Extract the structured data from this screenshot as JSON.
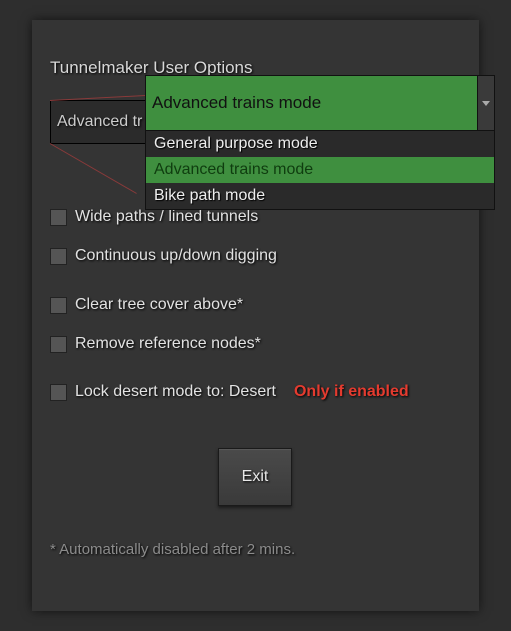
{
  "title": "Tunnelmaker User Options",
  "combo_visible_text": "Advanced tr",
  "dropdown": {
    "selected": "Advanced trains mode",
    "items": [
      {
        "label": "General purpose mode",
        "highlight": false
      },
      {
        "label": "Advanced trains mode",
        "highlight": true
      },
      {
        "label": "Bike path mode",
        "highlight": false
      }
    ]
  },
  "checks": {
    "wide_paths": "Wide paths / lined tunnels",
    "continuous": "Continuous up/down digging",
    "clear_tree": "Clear tree cover above*",
    "remove_ref": "Remove reference nodes*",
    "lock_desert": "Lock desert mode to: Desert"
  },
  "red_note": "Only if enabled",
  "exit_label": "Exit",
  "footnote": "* Automatically disabled after 2 mins."
}
